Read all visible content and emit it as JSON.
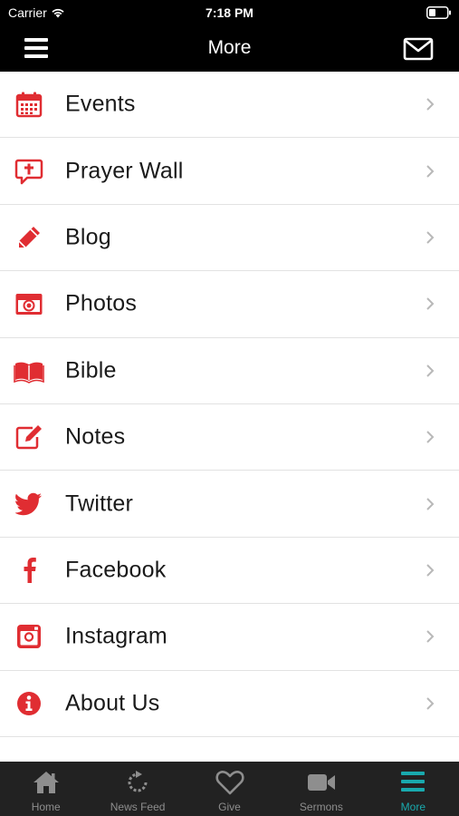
{
  "status_bar": {
    "carrier": "Carrier",
    "time": "7:18 PM"
  },
  "nav": {
    "title": "More"
  },
  "accent_color": "#e02d32",
  "active_tab_color": "#19a9ad",
  "items": [
    {
      "label": "Events",
      "icon": "calendar-icon"
    },
    {
      "label": "Prayer Wall",
      "icon": "prayer-bubble-icon"
    },
    {
      "label": "Blog",
      "icon": "pencil-icon"
    },
    {
      "label": "Photos",
      "icon": "camera-icon"
    },
    {
      "label": "Bible",
      "icon": "book-icon"
    },
    {
      "label": "Notes",
      "icon": "edit-note-icon"
    },
    {
      "label": "Twitter",
      "icon": "twitter-icon"
    },
    {
      "label": "Facebook",
      "icon": "facebook-icon"
    },
    {
      "label": "Instagram",
      "icon": "instagram-icon"
    },
    {
      "label": "About Us",
      "icon": "info-icon"
    }
  ],
  "tabs": [
    {
      "label": "Home",
      "icon": "home-icon"
    },
    {
      "label": "News Feed",
      "icon": "refresh-icon"
    },
    {
      "label": "Give",
      "icon": "heart-icon"
    },
    {
      "label": "Sermons",
      "icon": "video-camera-icon"
    },
    {
      "label": "More",
      "icon": "hamburger-icon",
      "active": true
    }
  ]
}
